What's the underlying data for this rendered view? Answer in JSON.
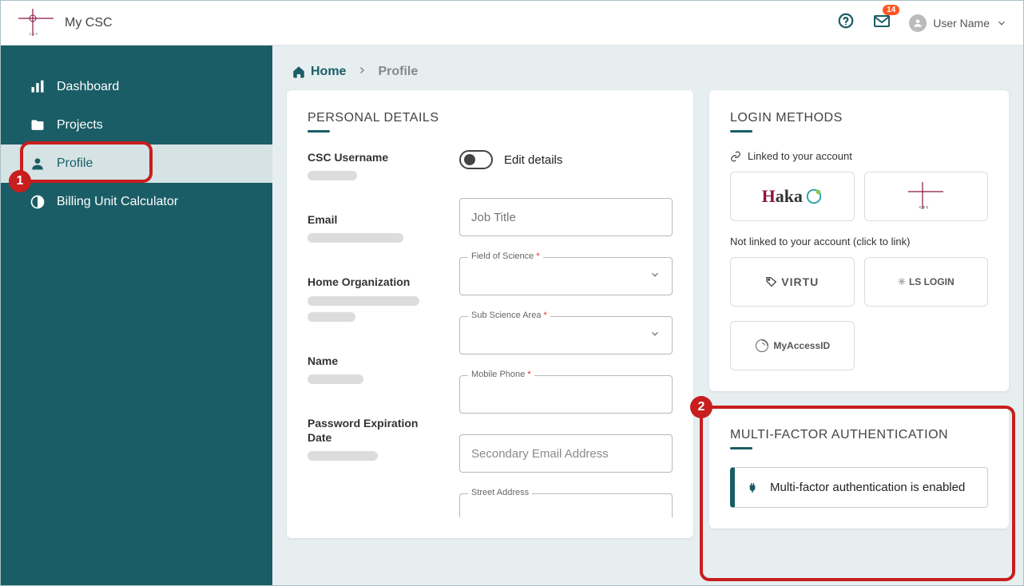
{
  "header": {
    "app_name": "My CSC",
    "notifications_count": "14",
    "user_name": "User Name"
  },
  "sidebar": {
    "items": [
      {
        "label": "Dashboard"
      },
      {
        "label": "Projects"
      },
      {
        "label": "Profile"
      },
      {
        "label": "Billing Unit Calculator"
      }
    ]
  },
  "breadcrumbs": {
    "home": "Home",
    "current": "Profile"
  },
  "personal_details": {
    "title": "PERSONAL DETAILS",
    "fields": {
      "csc_username": "CSC Username",
      "email": "Email",
      "home_org": "Home Organization",
      "name": "Name",
      "pw_exp": "Password Expiration Date"
    },
    "edit_toggle_label": "Edit details",
    "inputs": {
      "job_title_placeholder": "Job Title",
      "field_of_science_label": "Field of Science",
      "sub_science_label": "Sub Science Area",
      "mobile_phone_label": "Mobile Phone",
      "secondary_email_placeholder": "Secondary Email Address",
      "street_address_label": "Street Address"
    }
  },
  "login_methods": {
    "title": "LOGIN METHODS",
    "linked_label": "Linked to your account",
    "not_linked_label": "Not linked to your account (click to link)",
    "linked": [
      "Haka",
      "CSC"
    ],
    "not_linked": [
      "VIRTU",
      "LS LOGIN",
      "MyAccessID"
    ]
  },
  "mfa": {
    "title": "MULTI-FACTOR AUTHENTICATION",
    "status": "Multi-factor authentication is enabled"
  },
  "annotations": {
    "a1": "1",
    "a2": "2"
  }
}
